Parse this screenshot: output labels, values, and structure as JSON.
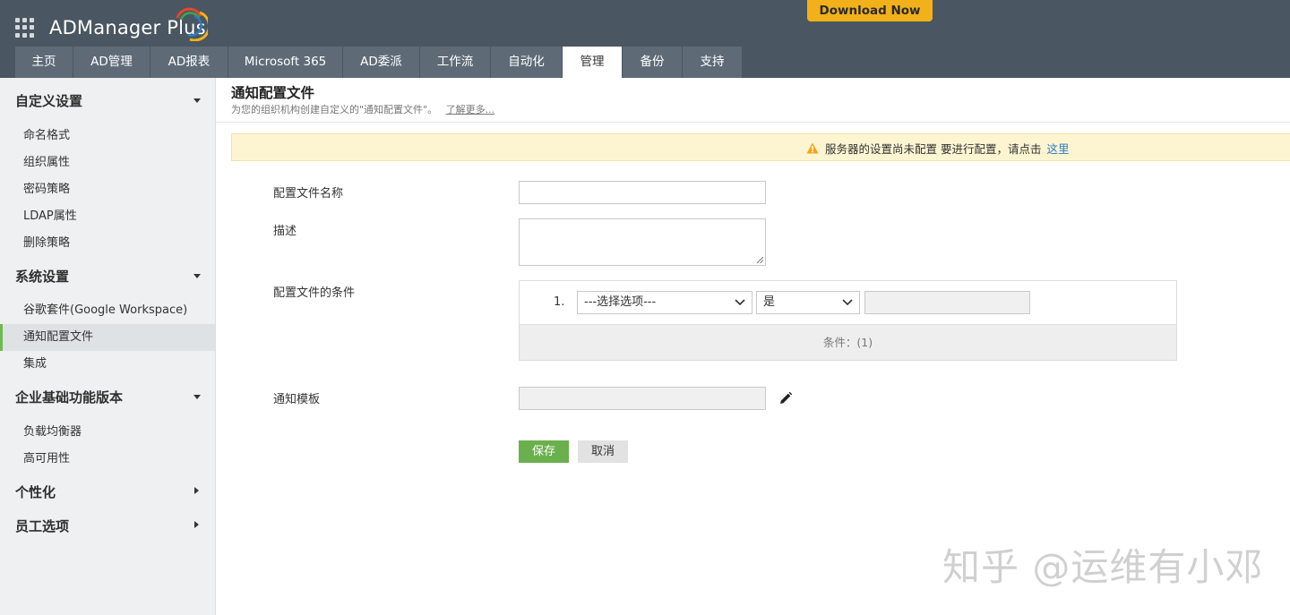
{
  "header": {
    "logo_text": "ADManager Plus",
    "download_label": "Download Now",
    "tabs": [
      {
        "label": "主页"
      },
      {
        "label": "AD管理"
      },
      {
        "label": "AD报表"
      },
      {
        "label": "Microsoft 365"
      },
      {
        "label": "AD委派"
      },
      {
        "label": "工作流"
      },
      {
        "label": "自动化"
      },
      {
        "label": "管理",
        "active": true
      },
      {
        "label": "备份"
      },
      {
        "label": "支持"
      }
    ]
  },
  "sidebar": {
    "sections": [
      {
        "title": "自定义设置",
        "expanded": true,
        "items": [
          "命名格式",
          "组织属性",
          "密码策略",
          "LDAP属性",
          "删除策略"
        ]
      },
      {
        "title": "系统设置",
        "expanded": true,
        "items": [
          "谷歌套件(Google Workspace)",
          "通知配置文件",
          "集成"
        ],
        "active_item": "通知配置文件"
      },
      {
        "title": "企业基础功能版本",
        "expanded": true,
        "items": [
          "负载均衡器",
          "高可用性"
        ]
      },
      {
        "title": "个性化",
        "expanded": false,
        "items": []
      },
      {
        "title": "员工选项",
        "expanded": false,
        "items": []
      }
    ]
  },
  "main": {
    "title": "通知配置文件",
    "subtitle": "为您的组织机构创建自定义的\"通知配置文件\"。",
    "learn_more": "了解更多...",
    "alert": {
      "text": "服务器的设置尚未配置 要进行配置，请点击",
      "link": "这里"
    },
    "form": {
      "profile_name_label": "配置文件名称",
      "profile_name_value": "",
      "description_label": "描述",
      "description_value": "",
      "conditions_label": "配置文件的条件",
      "condition_row": {
        "index": "1.",
        "option_select": "---选择选项---",
        "operator_select": "是",
        "value": ""
      },
      "conditions_count": "条件：(1)",
      "template_label": "通知模板",
      "template_value": "",
      "save_label": "保存",
      "cancel_label": "取消"
    }
  },
  "watermark": "知乎 @运维有小邓",
  "colors": {
    "header_bg": "#4a5661",
    "tab_bg": "#5e6b77",
    "download_btn": "#f2b11b",
    "save_btn": "#6ab04c",
    "alert_bg": "#fdf5d2",
    "link": "#2a7cc7"
  }
}
